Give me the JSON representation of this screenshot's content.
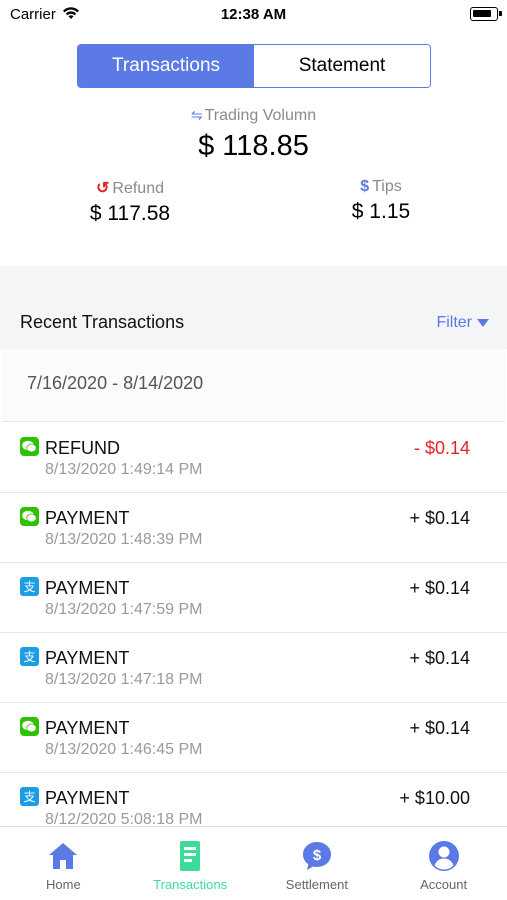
{
  "status_bar": {
    "carrier": "Carrier",
    "time": "12:38 AM"
  },
  "segment": {
    "tabs": [
      "Transactions",
      "Statement"
    ],
    "active": 0
  },
  "summary": {
    "trading_label": "Trading Volumn",
    "trading_icon": "⇋",
    "trading_amount": "$ 118.85",
    "refund_label": "Refund",
    "refund_icon": "↺",
    "refund_amount": "$ 117.58",
    "tips_label": "Tips",
    "tips_icon": "$",
    "tips_amount": "$ 1.15"
  },
  "recent": {
    "title": "Recent Transactions",
    "filter_label": "Filter",
    "date_range": "7/16/2020 - 8/14/2020"
  },
  "transactions": [
    {
      "type": "REFUND",
      "datetime": "8/13/2020 1:49:14 PM",
      "amount": "- $0.14",
      "method": "wechat-pay-icon",
      "negative": true
    },
    {
      "type": "PAYMENT",
      "datetime": "8/13/2020 1:48:39 PM",
      "amount": "+ $0.14",
      "method": "wechat-pay-icon",
      "negative": false
    },
    {
      "type": "PAYMENT",
      "datetime": "8/13/2020 1:47:59 PM",
      "amount": "+ $0.14",
      "method": "alipay-icon",
      "negative": false
    },
    {
      "type": "PAYMENT",
      "datetime": "8/13/2020 1:47:18 PM",
      "amount": "+ $0.14",
      "method": "alipay-icon",
      "negative": false
    },
    {
      "type": "PAYMENT",
      "datetime": "8/13/2020 1:46:45 PM",
      "amount": "+ $0.14",
      "method": "wechat-pay-icon",
      "negative": false
    },
    {
      "type": "PAYMENT",
      "datetime": "8/12/2020 5:08:18 PM",
      "amount": "+ $10.00",
      "method": "alipay-icon",
      "negative": false
    }
  ],
  "tabbar": [
    {
      "label": "Home",
      "icon": "home-icon"
    },
    {
      "label": "Transactions",
      "icon": "document-icon",
      "active": true
    },
    {
      "label": "Settlement",
      "icon": "dollar-chat-icon"
    },
    {
      "label": "Account",
      "icon": "user-icon"
    }
  ],
  "colors": {
    "accent": "#5b7ae5",
    "active_tab": "#3ddb9a",
    "negative": "#e02424",
    "wechat": "#2dc100",
    "alipay": "#1c9ee5"
  }
}
